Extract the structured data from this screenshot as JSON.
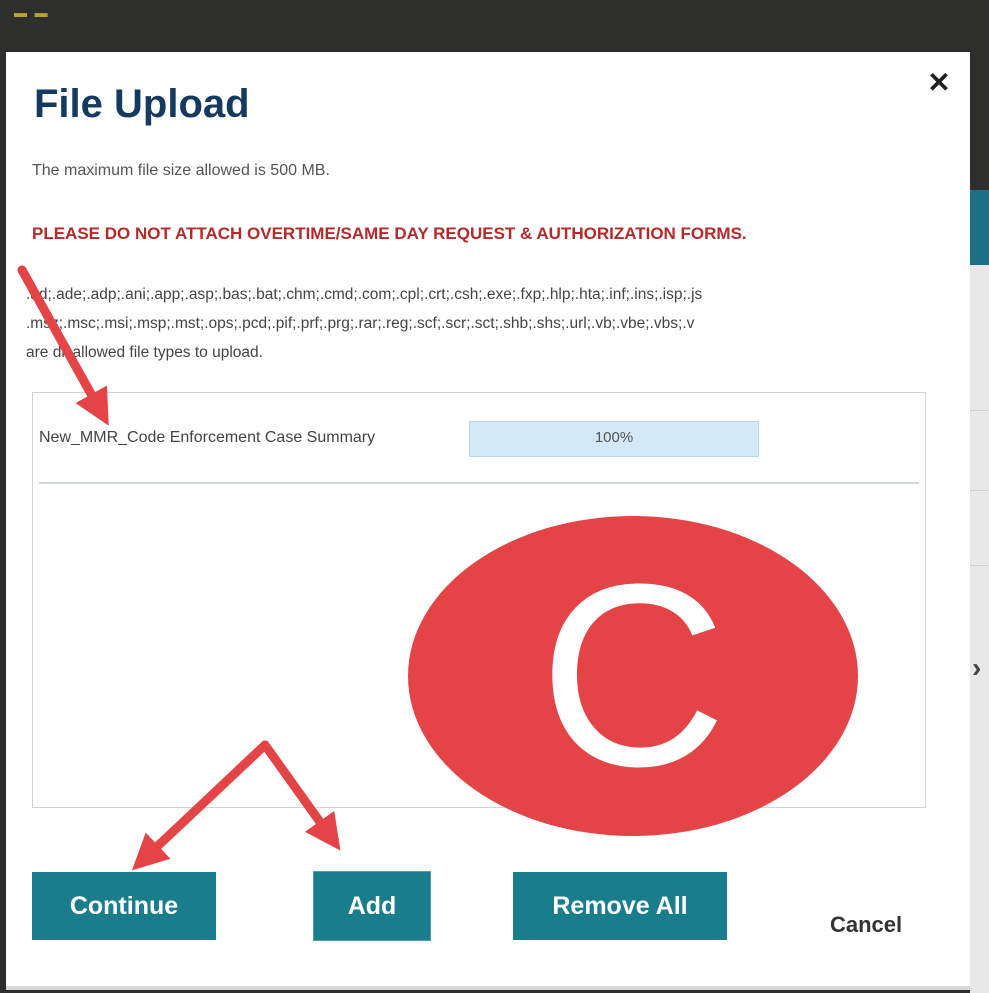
{
  "background": {
    "logo_text": "▬ ▬"
  },
  "modal": {
    "title": "File Upload",
    "close_glyph": "✕",
    "max_size_text": "The maximum file size allowed is 500 MB.",
    "warning_text": "PLEASE DO NOT ATTACH OVERTIME/SAME DAY REQUEST & AUTHORIZATION FORMS.",
    "disallowed_types_lines": [
      ".ad;.ade;.adp;.ani;.app;.asp;.bas;.bat;.chm;.cmd;.com;.cpl;.crt;.csh;.exe;.fxp;.hlp;.hta;.inf;.ins;.isp;.js",
      ".msz;.msc;.msi;.msp;.mst;.ops;.pcd;.pif;.prf;.prg;.rar;.reg;.scf;.scr;.sct;.shb;.shs;.url;.vb;.vbe;.vbs;.v",
      "are disallowed file types to upload."
    ],
    "file": {
      "name": "New_MMR_Code Enforcement Case Summary",
      "progress_label": "100%",
      "progress_fraction": 1.0
    },
    "badge_letter": "C",
    "buttons": {
      "continue_label": "Continue",
      "add_label": "Add",
      "remove_all_label": "Remove All",
      "cancel_label": "Cancel"
    }
  },
  "colors": {
    "title": "#163a5f",
    "warning": "#b42a2a",
    "button": "#1a7d8b",
    "annotation": "#e54447"
  }
}
